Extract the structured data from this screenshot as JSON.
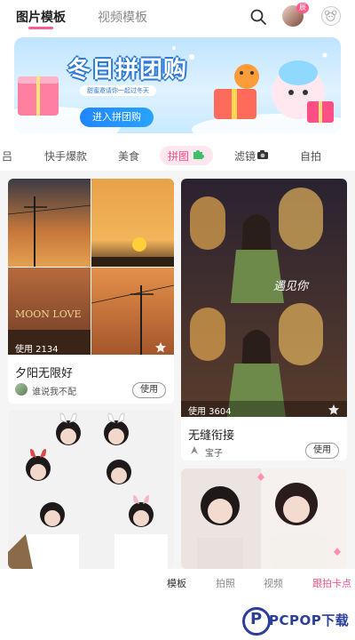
{
  "top_tabs": [
    {
      "label": "图片模板",
      "active": true
    },
    {
      "label": "视频模板",
      "active": false
    }
  ],
  "avatar_badge": "辰",
  "banner": {
    "title": "冬日拼团购",
    "subtitle": "甜蜜邀请你一起过冬天",
    "button": "进入拼团购"
  },
  "categories": [
    {
      "label": "吕",
      "active": false
    },
    {
      "label": "快手爆款",
      "active": false
    },
    {
      "label": "美食",
      "active": false
    },
    {
      "label": "拼图",
      "active": true,
      "icon": "puzzle-icon"
    },
    {
      "label": "滤镜",
      "active": false,
      "icon": "camera-icon"
    },
    {
      "label": "自拍",
      "active": false
    }
  ],
  "cards": [
    {
      "title": "夕阳无限好",
      "author": "谁说我不配",
      "use_count": "使用 2134",
      "use_label": "使用",
      "overlay_text": "MOON LOVE"
    },
    {
      "title": "无缝衔接",
      "author": "宝子",
      "use_count": "使用 3604",
      "use_label": "使用",
      "overlay_text": "遇见你"
    },
    {
      "title": "",
      "author": "",
      "use_count": "",
      "use_label": ""
    },
    {
      "title": "",
      "author": "",
      "use_count": "",
      "use_label": ""
    }
  ],
  "bottom_tabs": [
    {
      "label": "模板",
      "active": true
    },
    {
      "label": "拍照",
      "active": false
    },
    {
      "label": "视频",
      "active": false
    },
    {
      "label": "跟拍卡点",
      "active": false,
      "highlight": true
    }
  ],
  "watermark": {
    "text": "PCPOP下载"
  },
  "colors": {
    "accent": "#ff5b8a",
    "banner_blue": "#2c7ad6",
    "watermark": "#2b3e9a"
  }
}
